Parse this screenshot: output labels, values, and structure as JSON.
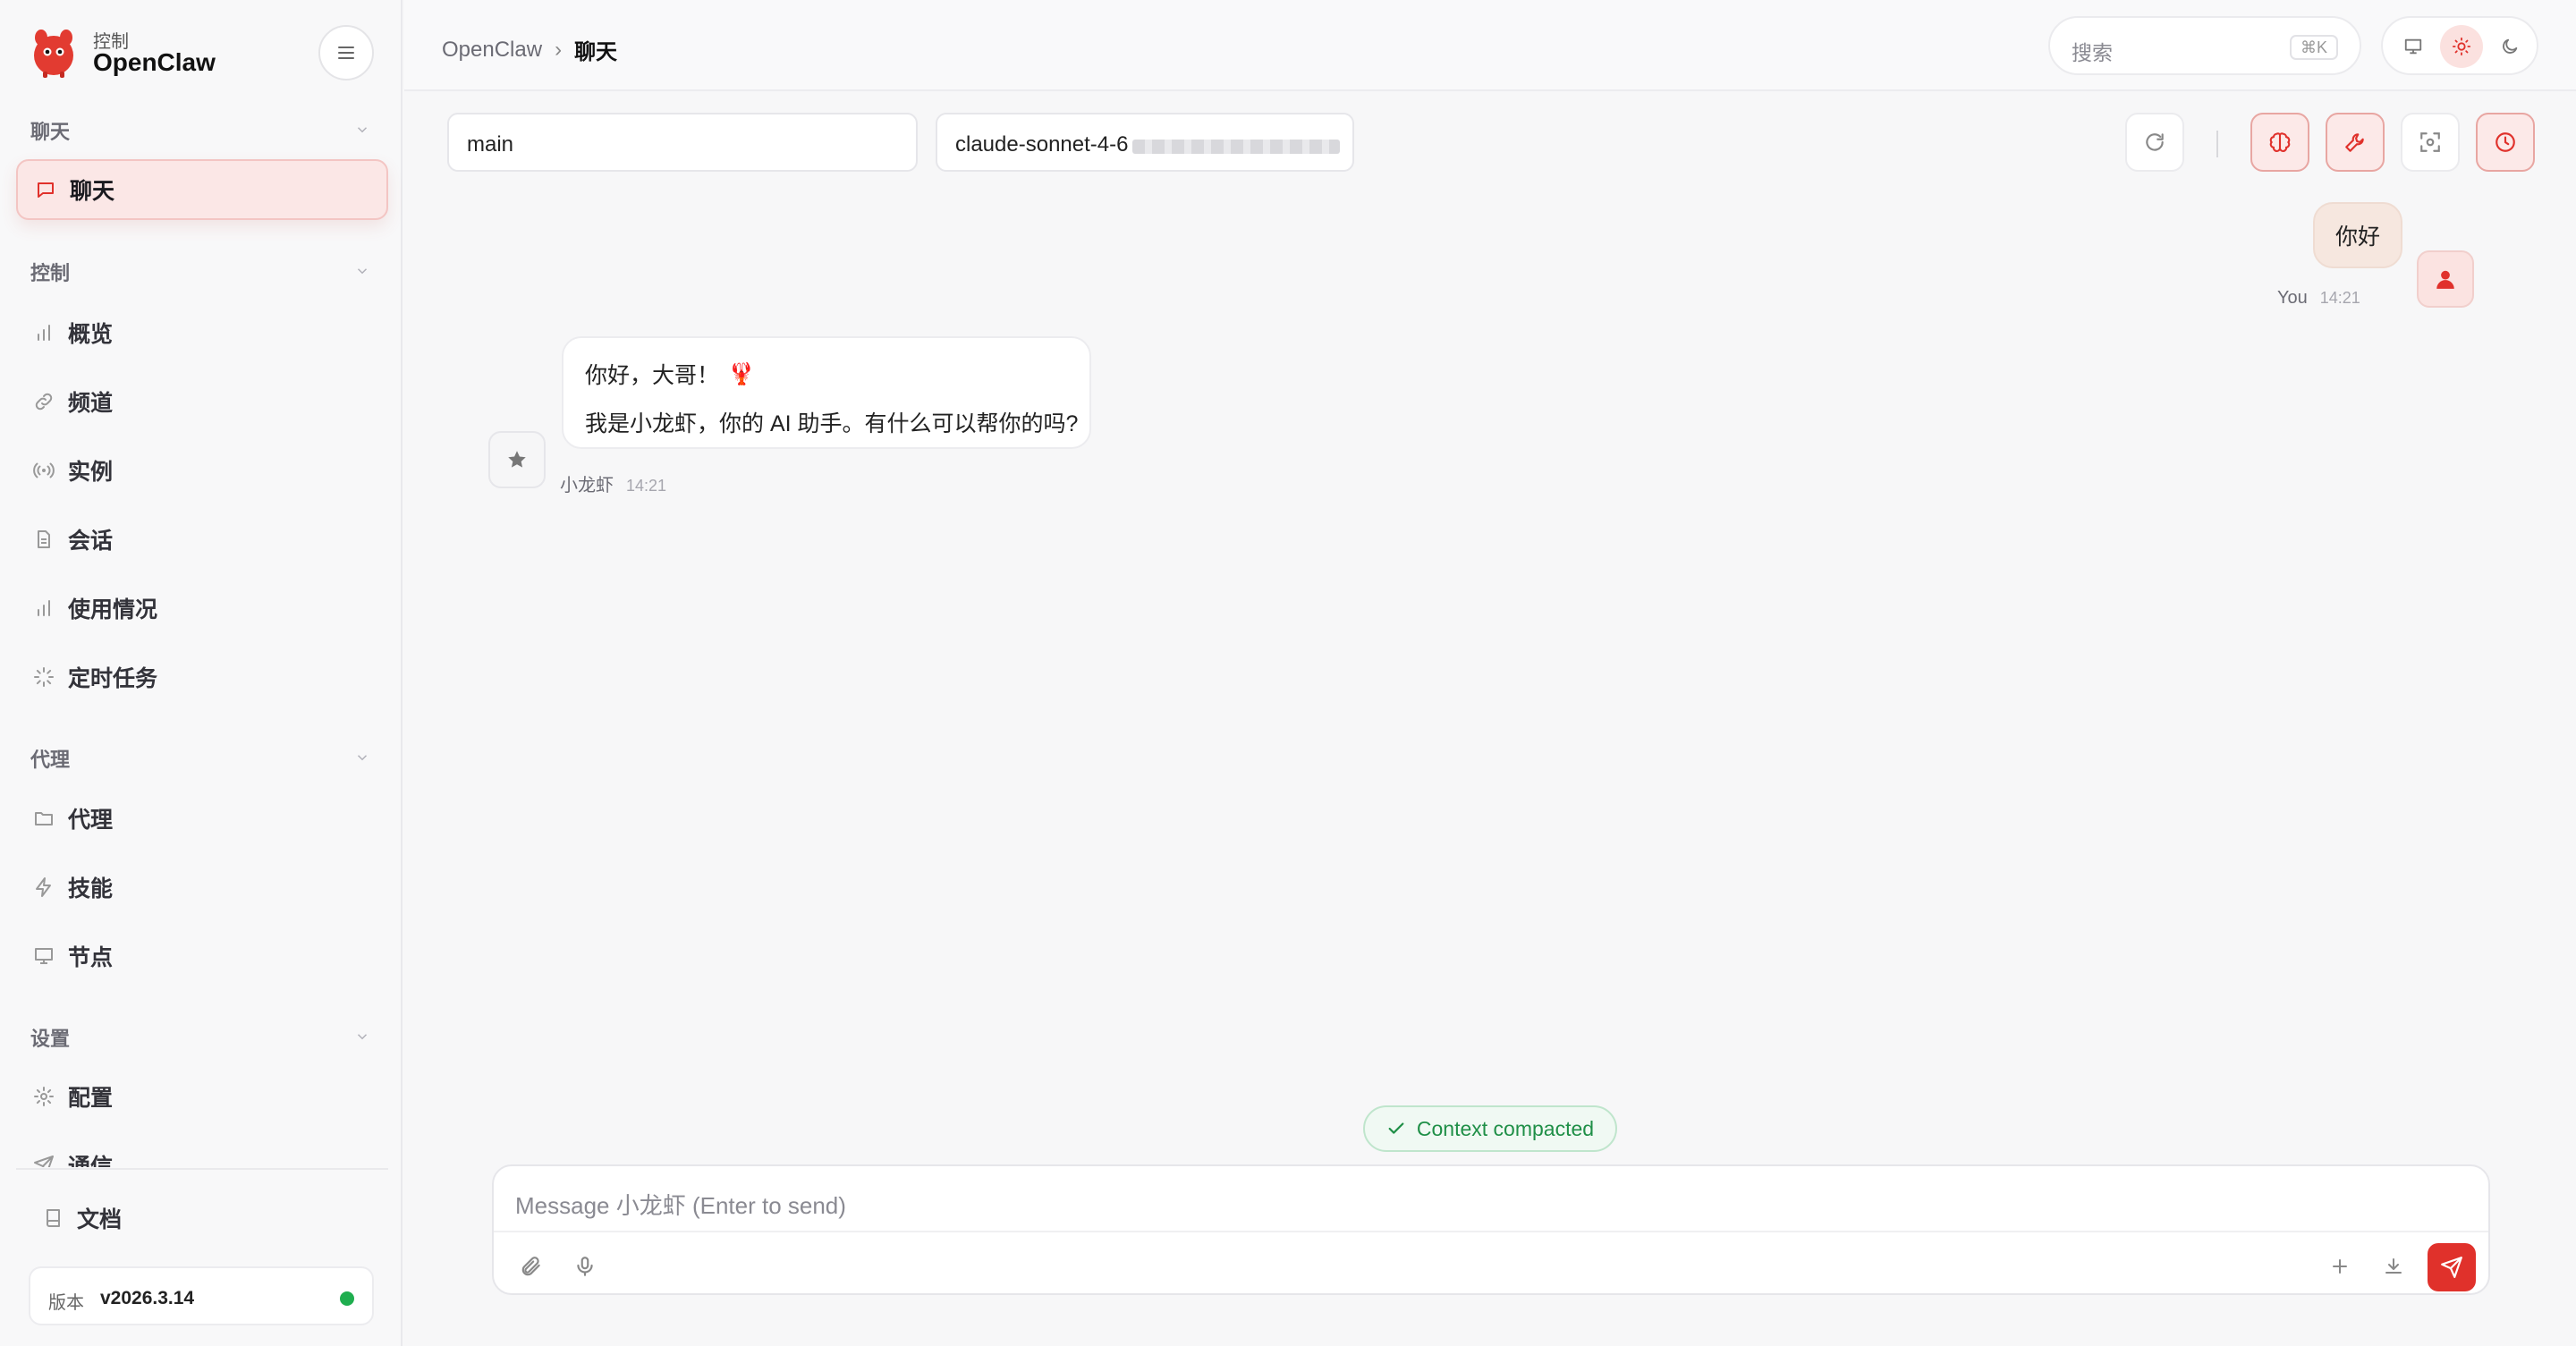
{
  "app": {
    "brand_sub": "控制",
    "brand_name": "OpenClaw"
  },
  "sidebar": {
    "sections": [
      {
        "title": "聊天",
        "items": [
          {
            "label": "聊天",
            "icon": "message-square-icon",
            "active": true
          }
        ]
      },
      {
        "title": "控制",
        "items": [
          {
            "label": "概览",
            "icon": "bar-chart-icon"
          },
          {
            "label": "频道",
            "icon": "link-icon"
          },
          {
            "label": "实例",
            "icon": "radio-icon"
          },
          {
            "label": "会话",
            "icon": "file-text-icon"
          },
          {
            "label": "使用情况",
            "icon": "bar-chart-icon"
          },
          {
            "label": "定时任务",
            "icon": "loader-icon"
          }
        ]
      },
      {
        "title": "代理",
        "items": [
          {
            "label": "代理",
            "icon": "folder-icon"
          },
          {
            "label": "技能",
            "icon": "zap-icon"
          },
          {
            "label": "节点",
            "icon": "monitor-icon"
          }
        ]
      },
      {
        "title": "设置",
        "items": [
          {
            "label": "配置",
            "icon": "gear-icon"
          },
          {
            "label": "通信",
            "icon": "send-icon"
          }
        ]
      }
    ],
    "docs_label": "文档",
    "version_key": "版本",
    "version_value": "v2026.3.14",
    "status_color": "#1fae4f"
  },
  "topbar": {
    "breadcrumb_root": "OpenClaw",
    "breadcrumb_sep": "›",
    "breadcrumb_current": "聊天",
    "search_placeholder": "搜索",
    "search_shortcut": "⌘K",
    "theme_options": [
      "system",
      "light",
      "dark"
    ],
    "theme_selected": "light"
  },
  "session": {
    "session_key": "main",
    "model": "claude-sonnet-4-6 ·"
  },
  "messages": [
    {
      "role": "user",
      "text": "你好",
      "author": "You",
      "time": "14:21"
    },
    {
      "role": "assistant",
      "lines": [
        "你好，大哥！",
        "我是小龙虾，你的 AI 助手。有什么可以帮你的吗?"
      ],
      "emoji": "🦞",
      "author": "小龙虾",
      "time": "14:21"
    }
  ],
  "toast": "Context compacted",
  "composer": {
    "placeholder": "Message 小龙虾 (Enter to send)"
  },
  "colors": {
    "accent": "#e0312b",
    "active_bg": "#fbe7e6",
    "success": "#1f8f47"
  }
}
